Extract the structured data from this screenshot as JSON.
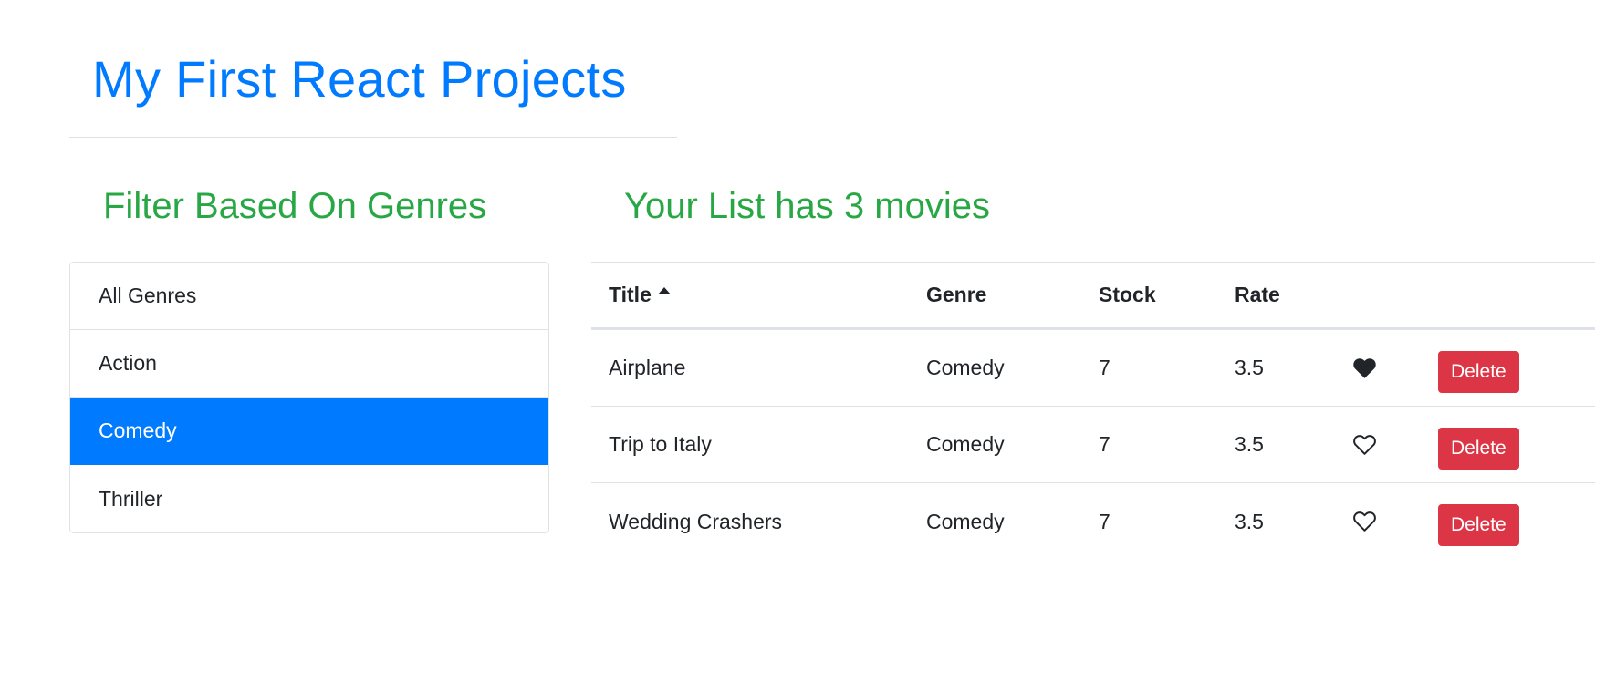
{
  "header": {
    "title": "My First React Projects"
  },
  "filter": {
    "heading": "Filter Based On Genres",
    "genres": [
      {
        "label": "All Genres",
        "active": false
      },
      {
        "label": "Action",
        "active": false
      },
      {
        "label": "Comedy",
        "active": true
      },
      {
        "label": "Thriller",
        "active": false
      }
    ]
  },
  "summary": {
    "heading": "Your List has 3 movies"
  },
  "table": {
    "columns": {
      "title": "Title",
      "genre": "Genre",
      "stock": "Stock",
      "rate": "Rate"
    },
    "sort_icon": "caret-up-icon",
    "rows": [
      {
        "title": "Airplane",
        "genre": "Comedy",
        "stock": "7",
        "rate": "3.5",
        "liked": true,
        "delete_label": "Delete"
      },
      {
        "title": "Trip to Italy",
        "genre": "Comedy",
        "stock": "7",
        "rate": "3.5",
        "liked": false,
        "delete_label": "Delete"
      },
      {
        "title": "Wedding Crashers",
        "genre": "Comedy",
        "stock": "7",
        "rate": "3.5",
        "liked": false,
        "delete_label": "Delete"
      }
    ]
  },
  "colors": {
    "primary": "#007bff",
    "success": "#28a745",
    "danger": "#dc3545",
    "text": "#212529"
  }
}
